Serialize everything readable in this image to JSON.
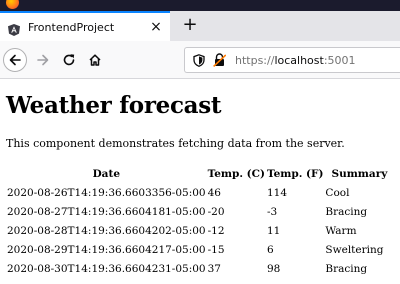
{
  "browser": {
    "tab": {
      "title": "FrontendProject",
      "close_glyph": "×"
    },
    "new_tab_glyph": "+",
    "url": {
      "scheme": "https://",
      "host": "localhost",
      "port": ":5001"
    },
    "icons": [
      "firefox-logo",
      "angular-favicon",
      "back-arrow",
      "forward-arrow",
      "reload",
      "home",
      "shield",
      "lock"
    ]
  },
  "page": {
    "title": "Weather forecast",
    "intro": "This component demonstrates fetching data from the server.",
    "table": {
      "headers": [
        "Date",
        "Temp. (C)",
        "Temp. (F)",
        "Summary"
      ],
      "rows": [
        [
          "2020-08-26T14:19:36.6603356-05:00",
          "46",
          "114",
          "Cool"
        ],
        [
          "2020-08-27T14:19:36.6604181-05:00",
          "-20",
          "-3",
          "Bracing"
        ],
        [
          "2020-08-28T14:19:36.6604202-05:00",
          "-12",
          "11",
          "Warm"
        ],
        [
          "2020-08-29T14:19:36.6604217-05:00",
          "-15",
          "6",
          "Sweltering"
        ],
        [
          "2020-08-30T14:19:36.6604231-05:00",
          "37",
          "98",
          "Bracing"
        ]
      ]
    }
  }
}
